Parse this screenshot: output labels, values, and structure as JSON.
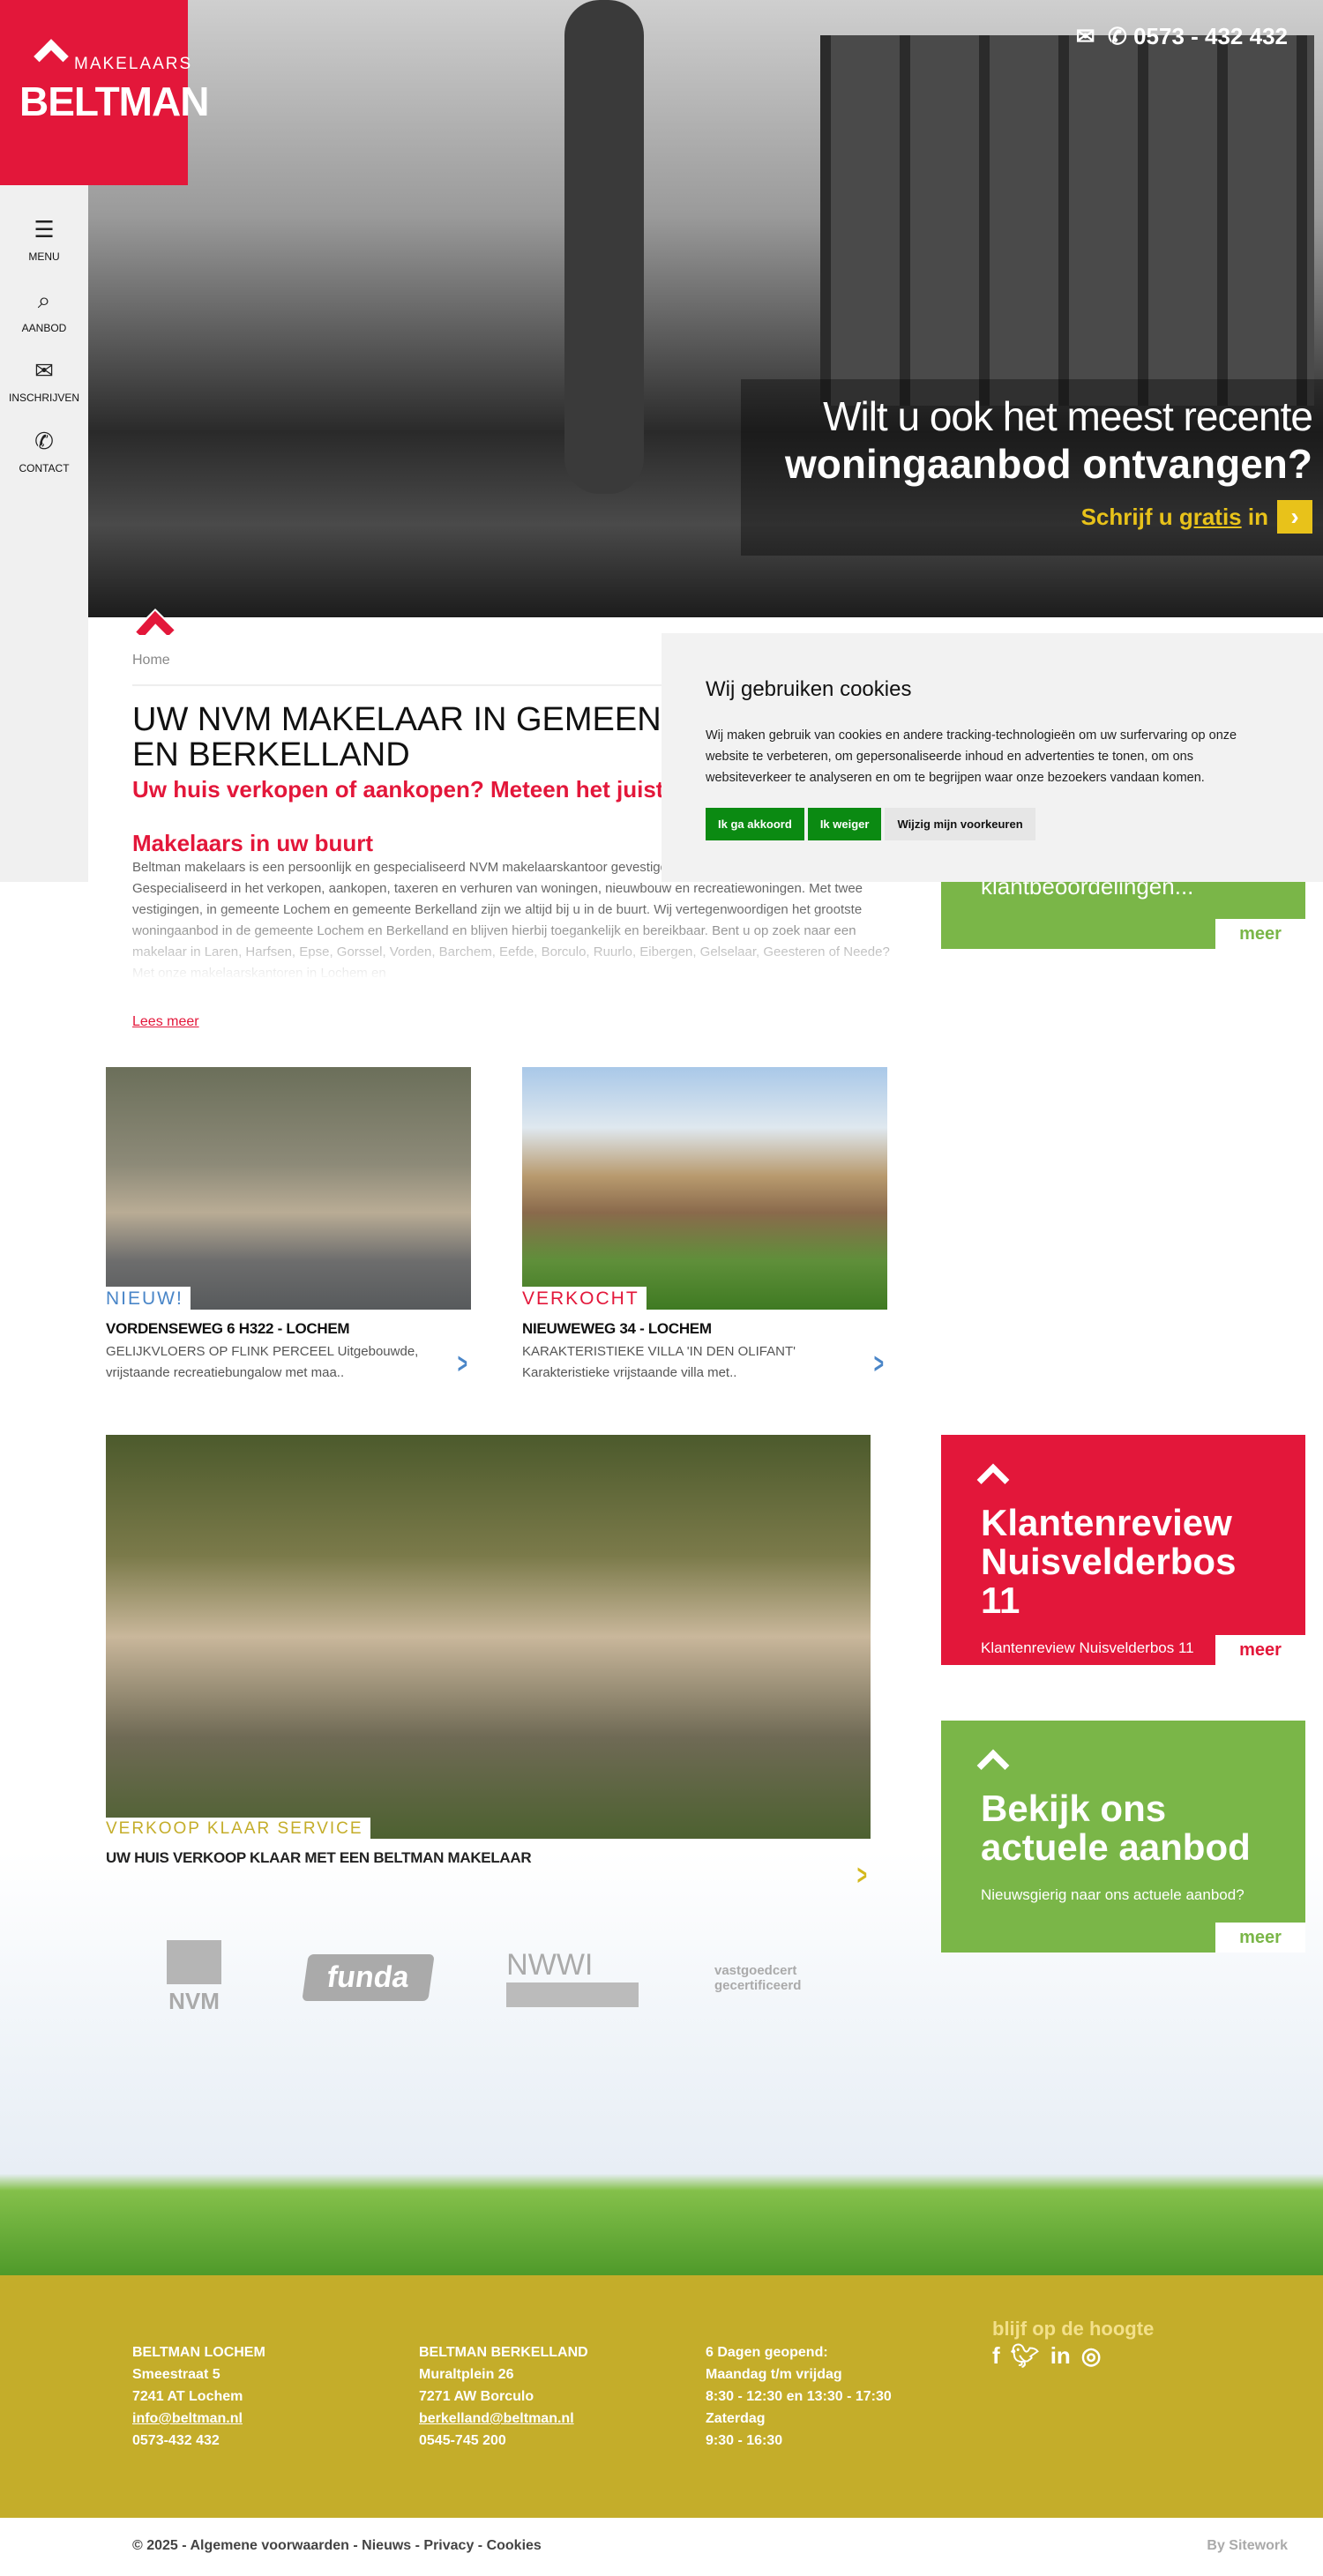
{
  "brand": {
    "top": "MAKELAARS",
    "name": "BELTMAN",
    "red": "#e3173a",
    "green": "#7ab648",
    "gold": "#c4ad2a"
  },
  "header": {
    "phone": "0573 - 432 432",
    "mail_icon": "envelope-icon",
    "phone_icon": "phone-icon"
  },
  "sidebar": {
    "items": [
      {
        "label": "MENU",
        "icon": "hamburger-icon"
      },
      {
        "label": "AANBOD",
        "icon": "search-icon"
      },
      {
        "label": "INSCHRIJVEN",
        "icon": "envelope-icon"
      },
      {
        "label": "CONTACT",
        "icon": "phone-icon"
      }
    ]
  },
  "hero": {
    "line1": "Wilt u ook het meest recente",
    "line2": "woningaanbod ontvangen?",
    "cta_pre": "Schrijf u ",
    "cta_link": "gratis",
    "cta_post": " in"
  },
  "main": {
    "breadcrumb": "Home",
    "title": "UW NVM MAKELAAR IN GEMEENTE LOCHEM EN BERKELLAND",
    "subtitle": "Uw huis verkopen of aankopen? Meteen het juiste advies!",
    "section_title": "Makelaars in uw buurt",
    "paragraph": "Beltman makelaars is een persoonlijk en gespecialiseerd NVM makelaarskantoor gevestigd in Lochem en Borculo. Gespecialiseerd in het verkopen, aankopen, taxeren en verhuren van woningen, nieuwbouw en recreatiewoningen. Met twee vestigingen, in gemeente Lochem en gemeente Berkelland zijn we altijd bij u in de buurt. Wij vertegenwoordigen het grootste woningaanbod in de gemeente Lochem en Berkelland en blijven hierbij toegankelijk en bereikbaar. Bent u op zoek naar een makelaar in Laren, Harfsen, Epse, Gorssel, Vorden, Barchem, Eefde, Borculo, Ruurlo, Eibergen, Gelselaar, Geesteren of Neede? Met onze makelaarskantoren in Lochem en",
    "read_more": "Lees meer"
  },
  "cookie": {
    "title": "Wij gebruiken cookies",
    "text": "Wij maken gebruik van cookies en andere tracking-technologieën om uw surfervaring op onze website te verbeteren, om gepersonaliseerde inhoud en advertenties te tonen, om ons websiteverkeer te analyseren en om te begrijpen waar onze bezoekers vandaan komen.",
    "accept": "Ik ga akkoord",
    "reject": "Ik weiger",
    "prefs": "Wijzig mijn voorkeuren"
  },
  "review_box": {
    "text": "klantbeoordelingen...",
    "more": "meer"
  },
  "listings": [
    {
      "tag": "NIEUW!",
      "tag_color": "#4a86c8",
      "title": "VORDENSEWEG 6 H322 - LOCHEM",
      "desc": "GELIJKVLOERS OP FLINK PERCEEL Uitgebouwde, vrijstaande recreatiebungalow met maa.."
    },
    {
      "tag": "VERKOCHT",
      "tag_color": "#e3173a",
      "title": "NIEUWEWEG 34 - LOCHEM",
      "desc": "KARAKTERISTIEKE VILLA 'IN DEN OLIFANT' Karakteristieke vrijstaande villa met.."
    }
  ],
  "feature": {
    "tag": "VERKOOP KLAAR SERVICE",
    "title": "UW HUIS VERKOOP KLAAR MET EEN BELTMAN MAKELAAR"
  },
  "boxes": [
    {
      "title": "Klantenreview Nuisvelderbos 11",
      "text": "Klantenreview Nuisvelderbos 11",
      "more": "meer"
    },
    {
      "title": "Bekijk ons actuele aanbod",
      "text": "Nieuwsgierig naar ons actuele aanbod?",
      "more": "meer"
    }
  ],
  "partners": [
    "NVM",
    "funda",
    "NWWI",
    "vastgoedcert gecertificeerd"
  ],
  "footer": {
    "lochem": {
      "name": "BELTMAN LOCHEM",
      "street": "Smeestraat 5",
      "city": "7241 AT Lochem",
      "email": "info@beltman.nl",
      "phone": "0573-432 432"
    },
    "berkelland": {
      "name": "BELTMAN BERKELLAND",
      "street": "Muraltplein 26",
      "city": "7271 AW Borculo",
      "email": "berkelland@beltman.nl",
      "phone": "0545-745 200"
    },
    "hours": {
      "title": "6 Dagen geopend:",
      "l1": "Maandag t/m vrijdag",
      "l2": "8:30 - 12:30 en 13:30 - 17:30",
      "l3": "Zaterdag",
      "l4": "9:30 - 16:30"
    },
    "social_title": "blijf op de hoogte",
    "social": [
      "facebook-icon",
      "twitter-icon",
      "linkedin-icon",
      "instagram-icon"
    ]
  },
  "bottom": {
    "copy": "© 2025 - ",
    "links": [
      "Algemene voorwaarden",
      "Nieuws",
      "Privacy",
      "Cookies"
    ],
    "by": "By Sitework"
  }
}
